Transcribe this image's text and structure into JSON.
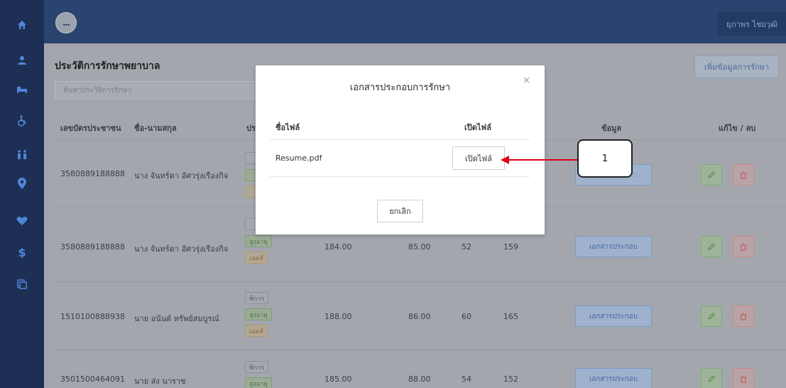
{
  "header": {
    "menu_label": "...",
    "user_name": "ยุภาพร ไชยวุฒิ"
  },
  "sidebar": {
    "icons": [
      "home-icon",
      "user-icon",
      "bed-icon",
      "wheelchair-icon",
      "people-icon",
      "location-pin-icon",
      "heart-icon",
      "dollar-icon",
      "copy-icon"
    ]
  },
  "main": {
    "title": "ประวัติการรักษาพยาบาล",
    "add_button": "เพิ่มข้อมูลการรักษา",
    "search_placeholder": "ค้นหาประวัติการรักษา",
    "columns": {
      "id": "เลขบัตรประชาชน",
      "name": "ชื่อ-นามสกุล",
      "category": "ประ",
      "info": "ข้อมูล",
      "edit_delete": "แก้ไข / ลบ"
    },
    "rows": [
      {
        "id": "3580889188888",
        "name": "นาง จันทร์ดา อัศวรุ่งเรืองกิจ",
        "tags": [
          "",
          "",
          ""
        ],
        "v1": "",
        "v2": "",
        "v3": "",
        "v4": "",
        "doc": "เอกสารประกอบ"
      },
      {
        "id": "3580889188888",
        "name": "นาง จันทร์ดา อัศวรุ่งเรืองกิจ",
        "tags": [
          "",
          "สูงอายุ",
          "เอดส์"
        ],
        "v1": "184.00",
        "v2": "85.00",
        "v3": "52",
        "v4": "159",
        "doc": "เอกสารประกอบ"
      },
      {
        "id": "1510100888938",
        "name": "นาย อนันต์ ทรัพย์สมบูรณ์",
        "tags": [
          "พิการ",
          "สูงอายุ",
          "เอดส์"
        ],
        "v1": "188.00",
        "v2": "86.00",
        "v3": "60",
        "v4": "165",
        "doc": "เอกสารประกอบ"
      },
      {
        "id": "3501500464091",
        "name": "นาย ส่ง นาราช",
        "tags": [
          "พิการ",
          "สูงอายุ",
          ""
        ],
        "v1": "185.00",
        "v2": "88.00",
        "v3": "54",
        "v4": "152",
        "doc": "เอกสารประกอบ"
      }
    ]
  },
  "modal": {
    "title": "เอกสารประกอบการรักษา",
    "close": "×",
    "col_filename": "ชื่อไฟล์",
    "col_open": "เปิดไฟล์",
    "file_name": "Resume.pdf",
    "open_button": "เปิดไฟล์",
    "cancel_button": "ยกเลิก"
  },
  "callout": {
    "number": "1"
  },
  "colors": {
    "sidebar": "#1d2f54",
    "topbar": "#2b436f",
    "arrow": "#e0001b"
  }
}
